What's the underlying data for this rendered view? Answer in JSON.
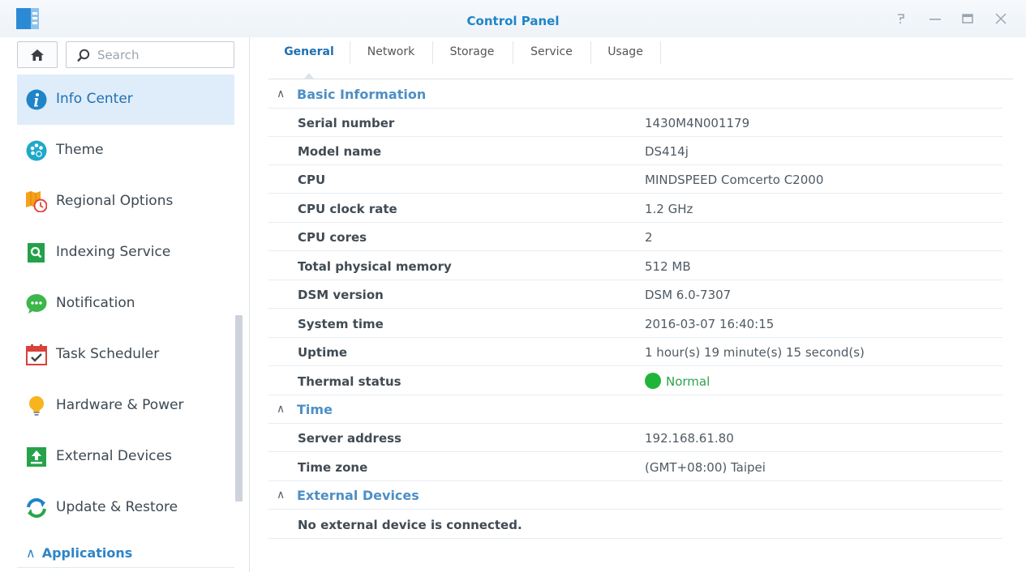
{
  "window": {
    "title": "Control Panel",
    "buttons": [
      "help-icon",
      "minimize-icon",
      "maximize-icon",
      "close-icon"
    ]
  },
  "sidebar": {
    "search_placeholder": "Search",
    "items": [
      {
        "label": "Info Center",
        "icon": "info-icon",
        "active": true
      },
      {
        "label": "Theme",
        "icon": "palette-icon"
      },
      {
        "label": "Regional Options",
        "icon": "regional-icon"
      },
      {
        "label": "Indexing Service",
        "icon": "indexing-icon"
      },
      {
        "label": "Notification",
        "icon": "notification-icon"
      },
      {
        "label": "Task Scheduler",
        "icon": "calendar-icon"
      },
      {
        "label": "Hardware & Power",
        "icon": "lightbulb-icon"
      },
      {
        "label": "External Devices",
        "icon": "external-device-icon"
      },
      {
        "label": "Update & Restore",
        "icon": "update-icon"
      }
    ],
    "applications_header": "Applications"
  },
  "tabs": [
    {
      "label": "General",
      "active": true
    },
    {
      "label": "Network"
    },
    {
      "label": "Storage"
    },
    {
      "label": "Service"
    },
    {
      "label": "Usage"
    }
  ],
  "basic_information": {
    "title": "Basic Information",
    "rows": [
      {
        "label": "Serial number",
        "value": "1430M4N001179"
      },
      {
        "label": "Model name",
        "value": "DS414j"
      },
      {
        "label": "CPU",
        "value": "MINDSPEED Comcerto C2000"
      },
      {
        "label": "CPU clock rate",
        "value": "1.2 GHz"
      },
      {
        "label": "CPU cores",
        "value": "2"
      },
      {
        "label": "Total physical memory",
        "value": "512 MB"
      },
      {
        "label": "DSM version",
        "value": "DSM 6.0-7307"
      },
      {
        "label": "System time",
        "value": "2016-03-07 16:40:15"
      },
      {
        "label": "Uptime",
        "value": "1 hour(s) 19 minute(s) 15 second(s)"
      }
    ],
    "thermal": {
      "label": "Thermal status",
      "value": "Normal",
      "color": "#1fb53a"
    }
  },
  "time": {
    "title": "Time",
    "rows": [
      {
        "label": "Server address",
        "value": "192.168.61.80"
      },
      {
        "label": "Time zone",
        "value": "(GMT+08:00) Taipei"
      }
    ]
  },
  "external_devices": {
    "title": "External Devices",
    "message": "No external device is connected."
  },
  "colors": {
    "accent": "#1f84c9",
    "active_bg": "#deedf9",
    "section_title": "#4d8fc6"
  }
}
